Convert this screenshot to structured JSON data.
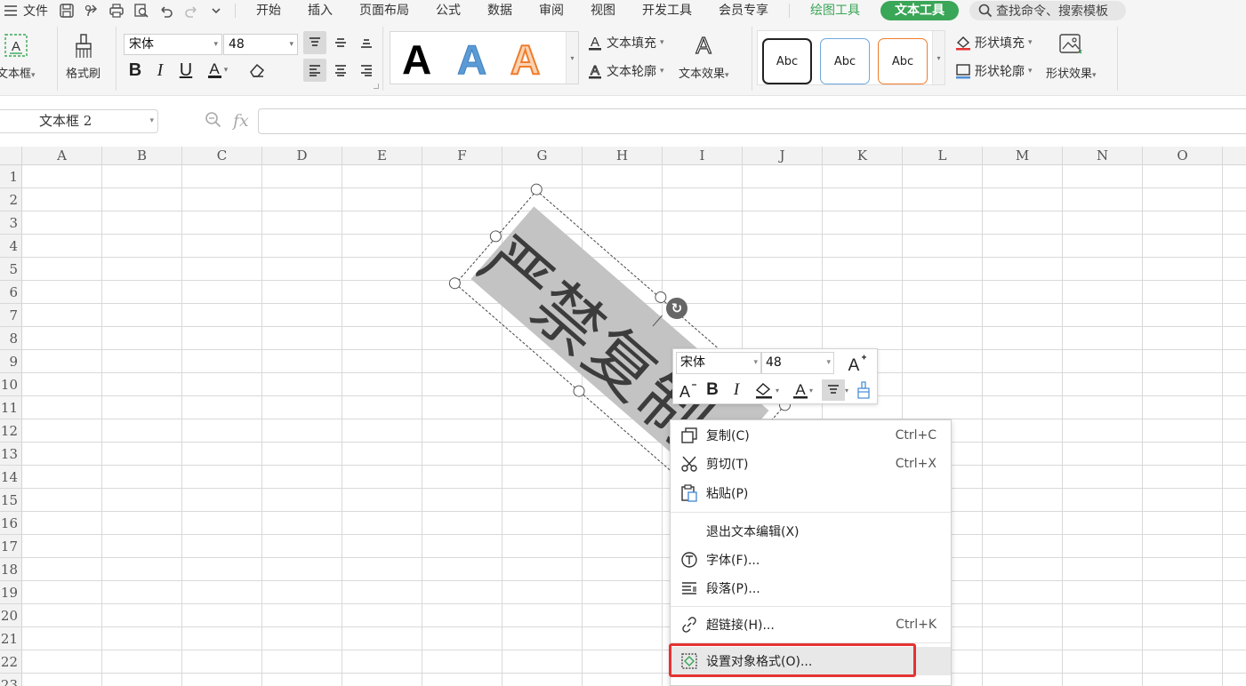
{
  "menubar": {
    "file_label": "文件",
    "tabs": [
      "开始",
      "插入",
      "页面布局",
      "公式",
      "数据",
      "审阅",
      "视图",
      "开发工具",
      "会员专享"
    ],
    "drawing_tools_label": "绘图工具",
    "text_tools_label": "文本工具",
    "search_placeholder": "查找命令、搜索模板"
  },
  "ribbon": {
    "textbox_label": "文本框",
    "format_painter_label": "格式刷",
    "font_name": "宋体",
    "font_size": "48",
    "text_fill_label": "文本填充",
    "text_outline_label": "文本轮廓",
    "text_effects_label": "文本效果",
    "style_glyph": "A",
    "shape_style_label": "Abc",
    "shape_fill_label": "形状填充",
    "shape_outline_label": "形状轮廓",
    "shape_effects_label": "形状效果",
    "accent_blue": "#4d8fd6",
    "accent_orange": "#ef7d2c",
    "accent_green": "#3aa657"
  },
  "formula_bar": {
    "name_box": "文本框 2",
    "fx_label": "fx",
    "formula_value": ""
  },
  "grid": {
    "columns": [
      "A",
      "B",
      "C",
      "D",
      "E",
      "F",
      "G",
      "H",
      "I",
      "J",
      "K",
      "L",
      "M",
      "N",
      "O"
    ],
    "rows": [
      "1",
      "2",
      "3",
      "4",
      "5",
      "6",
      "7",
      "8",
      "9",
      "10",
      "11",
      "12",
      "13",
      "14",
      "15",
      "16",
      "17",
      "18",
      "19",
      "20",
      "21",
      "22",
      "23"
    ]
  },
  "textbox": {
    "text": "严禁复制"
  },
  "mini_toolbar": {
    "font_name": "宋体",
    "font_size": "48"
  },
  "context_menu": {
    "items": [
      {
        "label": "复制(C)",
        "shortcut": "Ctrl+C"
      },
      {
        "label": "剪切(T)",
        "shortcut": "Ctrl+X"
      },
      {
        "label": "粘贴(P)",
        "shortcut": ""
      },
      {
        "label": "退出文本编辑(X)",
        "shortcut": ""
      },
      {
        "label": "字体(F)...",
        "shortcut": ""
      },
      {
        "label": "段落(P)...",
        "shortcut": ""
      },
      {
        "label": "超链接(H)...",
        "shortcut": "Ctrl+K"
      },
      {
        "label": "设置对象格式(O)...",
        "shortcut": ""
      }
    ],
    "highlight_color": "#e53333"
  }
}
